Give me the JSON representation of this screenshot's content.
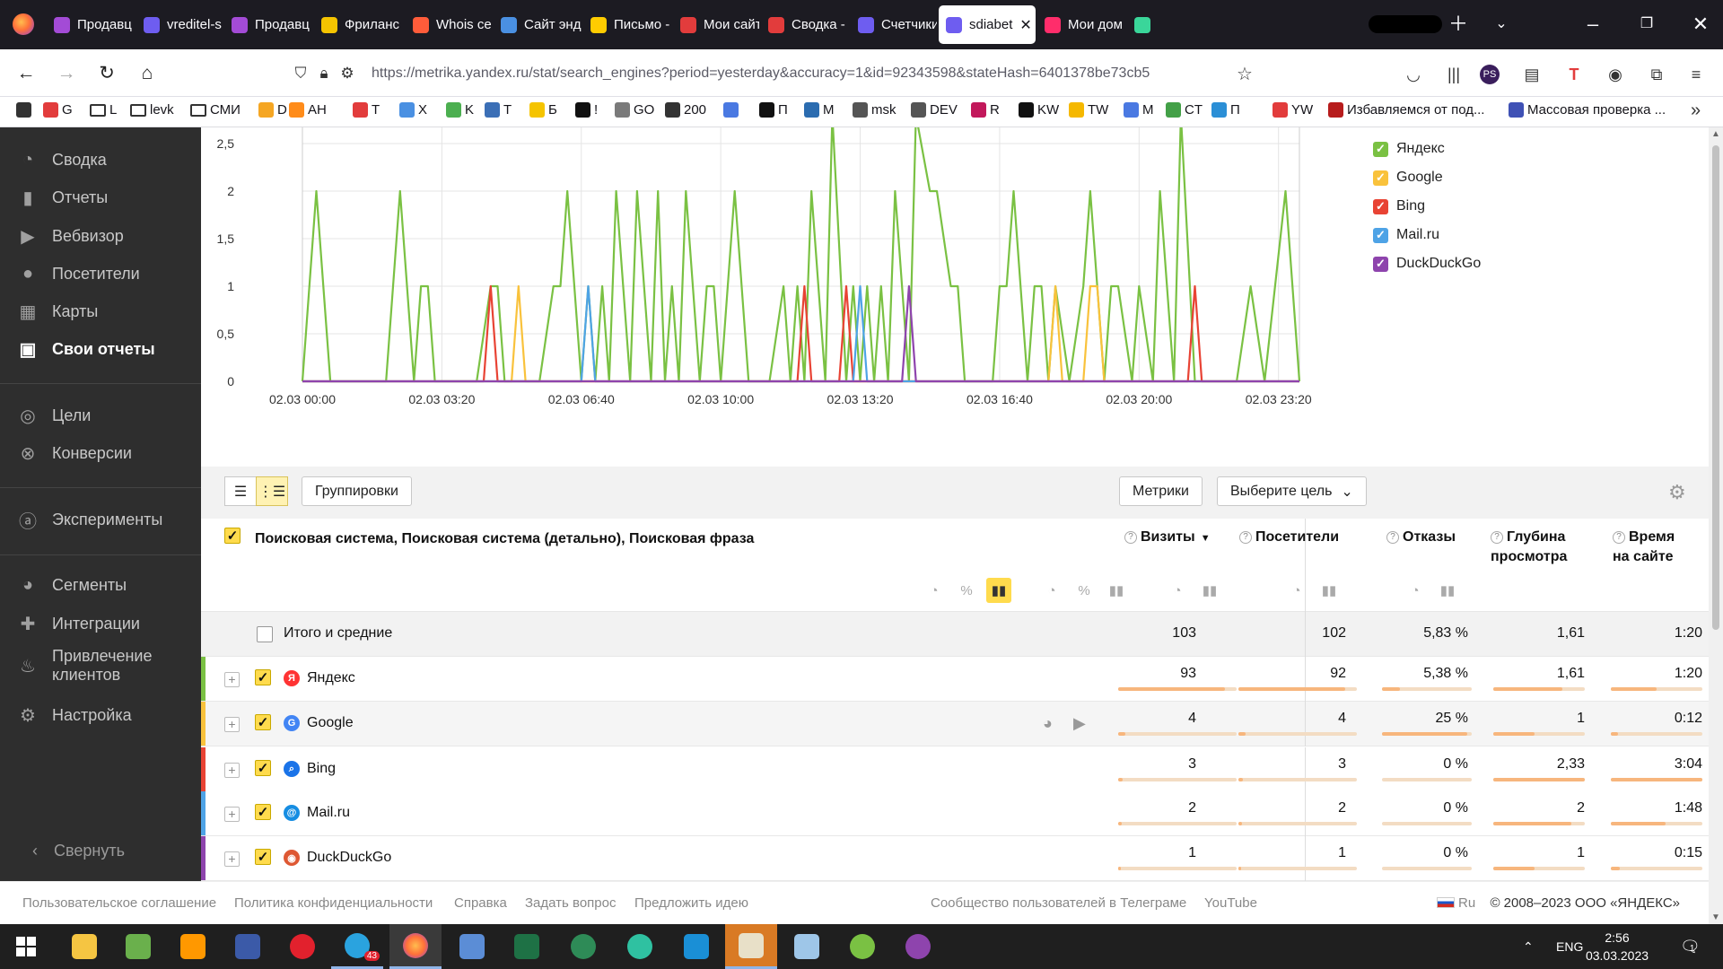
{
  "browser": {
    "tabs": [
      {
        "label": "Продавц",
        "color": "#a34bd6"
      },
      {
        "label": "vreditel-s",
        "color": "#6e5df0"
      },
      {
        "label": "Продавц",
        "color": "#a34bd6"
      },
      {
        "label": "Фриланс",
        "color": "#f5c400"
      },
      {
        "label": "Whois cep",
        "color": "#ff5c3a"
      },
      {
        "label": "Сайт энд",
        "color": "#4a90e2"
      },
      {
        "label": "Письмо -",
        "color": "#ffcc00"
      },
      {
        "label": "Мои сайт",
        "color": "#e23c3c"
      },
      {
        "label": "Сводка -",
        "color": "#e23c3c"
      },
      {
        "label": "Счетчики",
        "color": "#6e5df0"
      },
      {
        "label": "sdiabet",
        "color": "#6e5df0",
        "active": true
      },
      {
        "label": "Мои дом",
        "color": "#ff2d6b"
      },
      {
        "label": "",
        "color": "#3ad69a"
      }
    ],
    "url": "https://metrika.yandex.ru/stat/search_engines?period=yesterday&accuracy=1&id=92343598&stateHash=6401378be73cb5",
    "bookmarks": [
      {
        "label": "",
        "icon": "apple-icon",
        "color": "#333333"
      },
      {
        "label": "G",
        "icon": "puzzle-icon",
        "color": "#e23c3c"
      },
      {
        "label": "L",
        "icon": "folder-icon"
      },
      {
        "label": "levk",
        "icon": "folder-icon"
      },
      {
        "label": "СМИ",
        "icon": "folder-icon"
      },
      {
        "label": "D",
        "icon": "bolt-icon",
        "color": "#f5a623"
      },
      {
        "label": "AH",
        "icon": "a-icon",
        "color": "#ff8c1a"
      },
      {
        "label": "T",
        "icon": "t-icon",
        "color": "#e23c3c"
      },
      {
        "label": "X",
        "icon": "x-icon",
        "color": "#4a90e2"
      },
      {
        "label": "K",
        "icon": "ke-icon",
        "color": "#4caf50"
      },
      {
        "label": "T",
        "icon": "t-ring-icon",
        "color": "#3b6fb6"
      },
      {
        "label": "Б",
        "icon": "chat-icon",
        "color": "#f5c400"
      },
      {
        "label": "!",
        "icon": "k-icon",
        "color": "#111111"
      },
      {
        "label": "GO",
        "icon": "links-icon",
        "color": "#7a7a7a"
      },
      {
        "label": "200",
        "icon": "globe-icon",
        "color": "#333333"
      },
      {
        "label": "",
        "icon": "doc-icon",
        "color": "#4a79e2"
      },
      {
        "label": "П",
        "icon": "ps-icon",
        "color": "#111111"
      },
      {
        "label": "М",
        "icon": "outlook-icon",
        "color": "#2b6cb0"
      },
      {
        "label": "msk",
        "icon": "spider-icon",
        "color": "#555555"
      },
      {
        "label": "DEV",
        "icon": "spider-icon",
        "color": "#555555"
      },
      {
        "label": "R",
        "icon": "rus-lat-icon",
        "color": "#c2185b"
      },
      {
        "label": "KW",
        "icon": "k-icon",
        "color": "#111111"
      },
      {
        "label": "TW",
        "icon": "arrow-icon",
        "color": "#f5b800"
      },
      {
        "label": "M",
        "icon": "m-icon",
        "color": "#4a79e2"
      },
      {
        "label": "CT",
        "icon": "check-icon",
        "color": "#43a047"
      },
      {
        "label": "П",
        "icon": "triangle-icon",
        "color": "#2b8fd6"
      },
      {
        "label": "YW",
        "icon": "bars-icon",
        "color": "#e23c3c"
      },
      {
        "label": "Избавляемся от под...",
        "icon": "bike-icon",
        "color": "#b71c1c"
      },
      {
        "label": "Массовая проверка ...",
        "icon": "shield-icon",
        "color": "#3f51b5"
      }
    ]
  },
  "sidebar": {
    "items": [
      {
        "label": "Сводка",
        "icon": "gauge-icon"
      },
      {
        "label": "Отчеты",
        "icon": "bars-icon"
      },
      {
        "label": "Вебвизор",
        "icon": "play-icon"
      },
      {
        "label": "Посетители",
        "icon": "person-icon"
      },
      {
        "label": "Карты",
        "icon": "map-icon"
      },
      {
        "label": "Свои отчеты",
        "icon": "custom-report-icon",
        "active": true
      },
      {
        "label": "Цели",
        "icon": "target-icon"
      },
      {
        "label": "Конверсии",
        "icon": "conversion-icon"
      },
      {
        "label": "Эксперименты",
        "icon": "ab-icon"
      },
      {
        "label": "Сегменты",
        "icon": "pie-icon"
      },
      {
        "label": "Интеграции",
        "icon": "puzzle-icon"
      },
      {
        "label": "Привлечение клиентов",
        "icon": "flame-icon"
      },
      {
        "label": "Настройка",
        "icon": "gear-icon"
      }
    ],
    "collapse_label": "Свернуть"
  },
  "chart_data": {
    "type": "line",
    "ylim": [
      0,
      2.5
    ],
    "yticks": [
      "0",
      "0,5",
      "1",
      "1,5",
      "2",
      "2,5"
    ],
    "xticks": [
      "02.03 00:00",
      "02.03 03:20",
      "02.03 06:40",
      "02.03 10:00",
      "02.03 13:20",
      "02.03 16:40",
      "02.03 20:00",
      "02.03 23:20"
    ],
    "xmax": 143,
    "grid": true,
    "legend_position": "right",
    "series": [
      {
        "name": "Яндекс",
        "color": "#7ac143",
        "points": [
          [
            0,
            0
          ],
          [
            2,
            2
          ],
          [
            4,
            0
          ],
          [
            12,
            0
          ],
          [
            14,
            2
          ],
          [
            16,
            0
          ],
          [
            17,
            1
          ],
          [
            18,
            1
          ],
          [
            19,
            0
          ],
          [
            25,
            0
          ],
          [
            27,
            1
          ],
          [
            28,
            1
          ],
          [
            29,
            0
          ],
          [
            34,
            0
          ],
          [
            36,
            1
          ],
          [
            37,
            1
          ],
          [
            38,
            2
          ],
          [
            40,
            0
          ],
          [
            41,
            1
          ],
          [
            42,
            0
          ],
          [
            43,
            1
          ],
          [
            44,
            0
          ],
          [
            45,
            2
          ],
          [
            47,
            0
          ],
          [
            48,
            2
          ],
          [
            50,
            0
          ],
          [
            51,
            2
          ],
          [
            52,
            0
          ],
          [
            53,
            1
          ],
          [
            54,
            0
          ],
          [
            55,
            2
          ],
          [
            57,
            0
          ],
          [
            58,
            1
          ],
          [
            59,
            1
          ],
          [
            60,
            0
          ],
          [
            62,
            2
          ],
          [
            64,
            0
          ],
          [
            67,
            0
          ],
          [
            69,
            1
          ],
          [
            70,
            0
          ],
          [
            71,
            1
          ],
          [
            72,
            0
          ],
          [
            73,
            2
          ],
          [
            75,
            0
          ],
          [
            76,
            3
          ],
          [
            78,
            0
          ],
          [
            79,
            1
          ],
          [
            80,
            0
          ],
          [
            81,
            1
          ],
          [
            82,
            0
          ],
          [
            83,
            1
          ],
          [
            84,
            0
          ],
          [
            85,
            2
          ],
          [
            87,
            0
          ],
          [
            88,
            3
          ],
          [
            90,
            2
          ],
          [
            91,
            2
          ],
          [
            93,
            1
          ],
          [
            94,
            1
          ],
          [
            95,
            0
          ],
          [
            99,
            0
          ],
          [
            100,
            1
          ],
          [
            101,
            1
          ],
          [
            102,
            2
          ],
          [
            104,
            0
          ],
          [
            105,
            1
          ],
          [
            106,
            1
          ],
          [
            107,
            0
          ],
          [
            108,
            1
          ],
          [
            110,
            0
          ],
          [
            112,
            1
          ],
          [
            113,
            2
          ],
          [
            115,
            0
          ],
          [
            116,
            1
          ],
          [
            117,
            1
          ],
          [
            119,
            0
          ],
          [
            120,
            1
          ],
          [
            122,
            0
          ],
          [
            123,
            2
          ],
          [
            125,
            0
          ],
          [
            126,
            3
          ],
          [
            128,
            0
          ],
          [
            134,
            0
          ],
          [
            136,
            1
          ],
          [
            138,
            0
          ],
          [
            141,
            2
          ],
          [
            143,
            0
          ]
        ]
      },
      {
        "name": "Google",
        "color": "#f9c23c",
        "points": [
          [
            0,
            0
          ],
          [
            30,
            0
          ],
          [
            31,
            1
          ],
          [
            32,
            0
          ],
          [
            107,
            0
          ],
          [
            108,
            1
          ],
          [
            109,
            0
          ],
          [
            112,
            0
          ],
          [
            113,
            1
          ],
          [
            114,
            1
          ],
          [
            115,
            0
          ],
          [
            143,
            0
          ]
        ]
      },
      {
        "name": "Bing",
        "color": "#e84334",
        "points": [
          [
            0,
            0
          ],
          [
            26,
            0
          ],
          [
            27,
            1
          ],
          [
            28,
            0
          ],
          [
            71,
            0
          ],
          [
            72,
            1
          ],
          [
            73,
            0
          ],
          [
            77,
            0
          ],
          [
            78,
            1
          ],
          [
            79,
            0
          ],
          [
            127,
            0
          ],
          [
            128,
            1
          ],
          [
            129,
            0
          ],
          [
            143,
            0
          ]
        ]
      },
      {
        "name": "Mail.ru",
        "color": "#4ea3e6",
        "points": [
          [
            0,
            0
          ],
          [
            40,
            0
          ],
          [
            41,
            1
          ],
          [
            42,
            0
          ],
          [
            79,
            0
          ],
          [
            80,
            1
          ],
          [
            81,
            0
          ],
          [
            143,
            0
          ]
        ]
      },
      {
        "name": "DuckDuckGo",
        "color": "#8e44ad",
        "points": [
          [
            0,
            0
          ],
          [
            86,
            0
          ],
          [
            87,
            1
          ],
          [
            88,
            0
          ],
          [
            143,
            0
          ]
        ]
      }
    ]
  },
  "toolbar": {
    "groupings_label": "Группировки",
    "metrics_label": "Метрики",
    "goal_label": "Выберите цель"
  },
  "table": {
    "dimension_title": "Поисковая система, Поисковая система (детально), Поисковая фраза",
    "metrics": [
      {
        "label": "Визиты",
        "sorted": "▼"
      },
      {
        "label": "Посетители"
      },
      {
        "label": "Отказы"
      },
      {
        "label": "Глубина просмотра"
      },
      {
        "label": "Время на сайте"
      }
    ],
    "total": {
      "label": "Итого и средние",
      "values": [
        "103",
        "102",
        "5,83 %",
        "1,61",
        "1:20"
      ]
    },
    "rows": [
      {
        "name": "Яндекс",
        "icon": "yandex-icon",
        "color": "#7ac143",
        "values": [
          "93",
          "92",
          "5,38 %",
          "1,61",
          "1:20"
        ],
        "fills": [
          0.9,
          0.9,
          0.2,
          0.75,
          0.5
        ]
      },
      {
        "name": "Google",
        "icon": "google-icon",
        "color": "#f9c23c",
        "values": [
          "4",
          "4",
          "25 %",
          "1",
          "0:12"
        ],
        "fills": [
          0.06,
          0.06,
          0.95,
          0.45,
          0.08
        ]
      },
      {
        "name": "Bing",
        "icon": "bing-icon",
        "color": "#e84334",
        "values": [
          "3",
          "3",
          "0 %",
          "2,33",
          "3:04"
        ],
        "fills": [
          0.04,
          0.04,
          0.0,
          1.0,
          1.0
        ]
      },
      {
        "name": "Mail.ru",
        "icon": "mailru-icon",
        "color": "#4ea3e6",
        "values": [
          "2",
          "2",
          "0 %",
          "2",
          "1:48"
        ],
        "fills": [
          0.03,
          0.03,
          0.0,
          0.85,
          0.6
        ]
      },
      {
        "name": "DuckDuckGo",
        "icon": "duckduckgo-icon",
        "color": "#8e44ad",
        "values": [
          "1",
          "1",
          "0 %",
          "1",
          "0:15"
        ],
        "fills": [
          0.02,
          0.02,
          0.0,
          0.45,
          0.1
        ]
      }
    ]
  },
  "footer": {
    "links": [
      "Пользовательское соглашение",
      "Политика конфиденциальности",
      "Справка",
      "Задать вопрос",
      "Предложить идею"
    ],
    "telegram": "Сообщество пользователей в Телеграме",
    "youtube": "YouTube",
    "lang": "Ru",
    "copyright": "© 2008–2023  ООО «ЯНДЕКС»"
  },
  "taskbar": {
    "lang": "ENG",
    "time": "2:56",
    "date": "03.03.2023",
    "notification_count": "1",
    "telegram_badge": "43"
  }
}
